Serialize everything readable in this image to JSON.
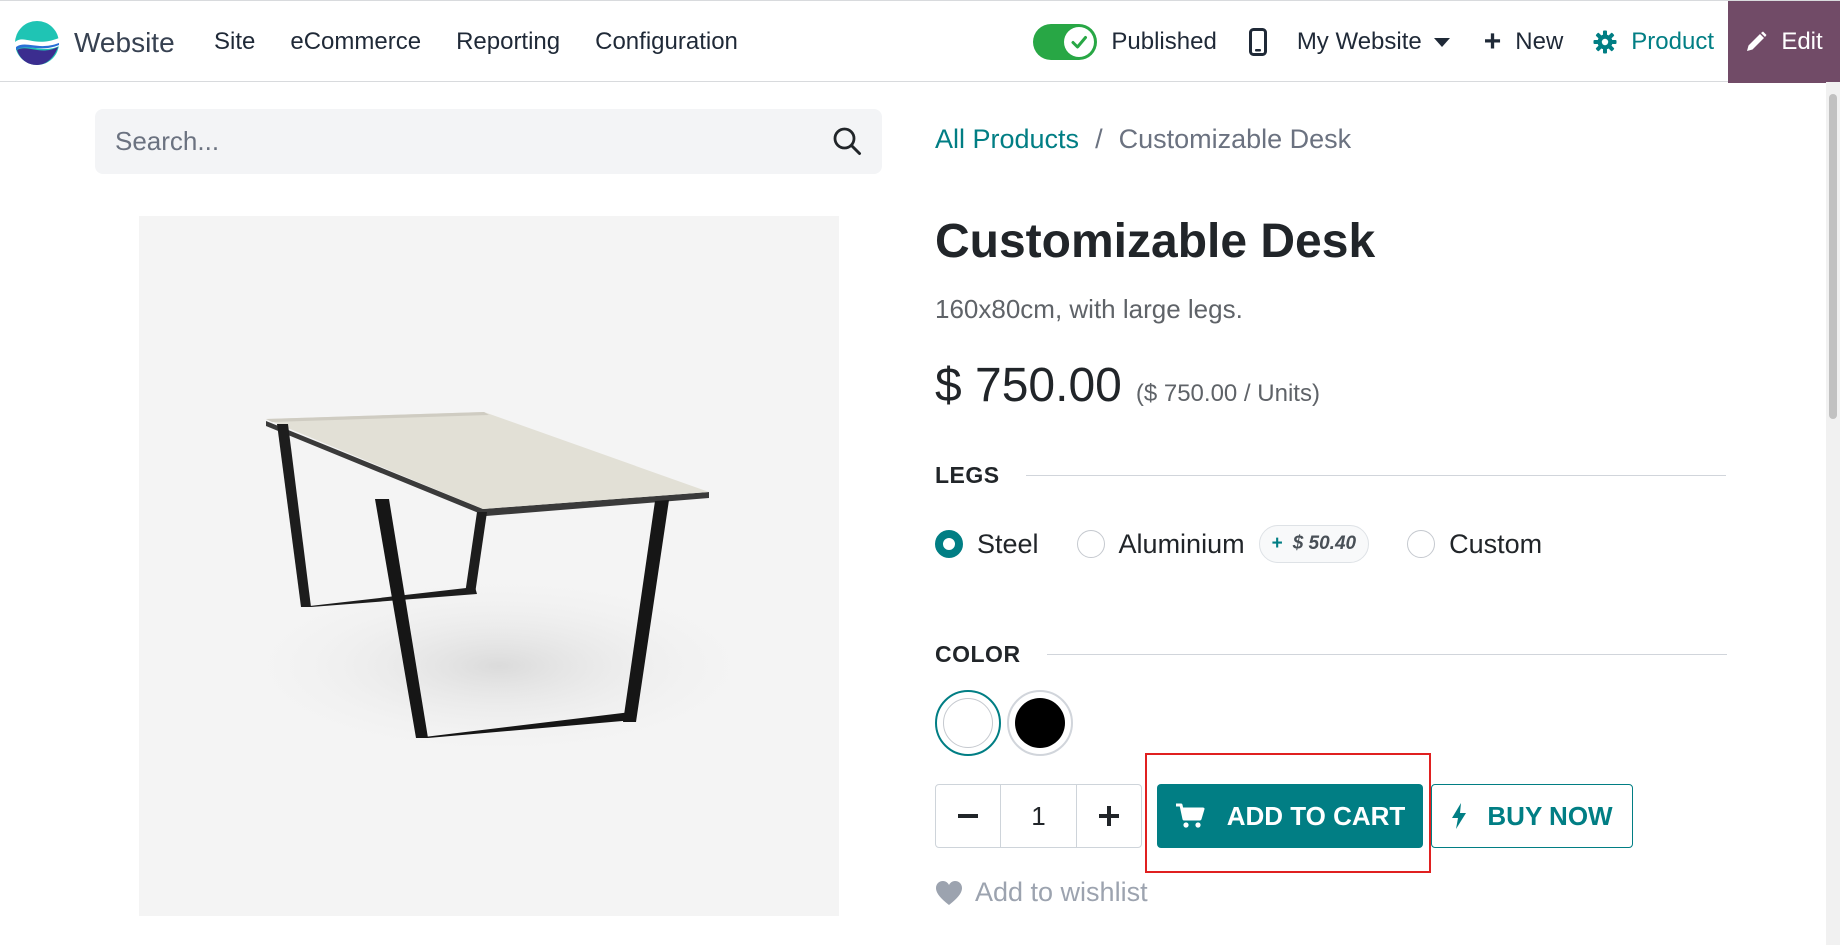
{
  "navbar": {
    "brand_label": "Website",
    "menu": [
      "Site",
      "eCommerce",
      "Reporting",
      "Configuration"
    ],
    "published_label": "Published",
    "published_on": true,
    "website_label": "My Website",
    "new_label": "New",
    "product_label": "Product",
    "edit_label": "Edit",
    "icons": [
      "website-logo-icon",
      "check-icon",
      "mobile-phone-icon",
      "caret-down-icon",
      "plus-icon",
      "gear-icon",
      "pencil-icon"
    ]
  },
  "search": {
    "placeholder": "Search..."
  },
  "breadcrumb": {
    "link": "All Products",
    "separator": "/",
    "current": "Customizable Desk"
  },
  "product": {
    "title": "Customizable Desk",
    "description": "160x80cm, with large legs.",
    "price": "$ 750.00",
    "unit_price": "($ 750.00 / Units)"
  },
  "legs": {
    "label": "LEGS",
    "options": [
      {
        "label": "Steel",
        "selected": true
      },
      {
        "label": "Aluminium",
        "selected": false,
        "extra_sign": "+",
        "extra_amount": "$ 50.40"
      },
      {
        "label": "Custom",
        "selected": false
      }
    ]
  },
  "color": {
    "label": "COLOR",
    "swatches": [
      {
        "name": "White",
        "hex": "#ffffff",
        "selected": true
      },
      {
        "name": "Black",
        "hex": "#000000",
        "selected": false
      }
    ]
  },
  "cart": {
    "quantity": "1",
    "add_to_cart_label": "ADD TO CART",
    "buy_now_label": "BUY NOW",
    "wishlist_label": "Add to wishlist"
  },
  "colors": {
    "primary": "#017e84",
    "edit_button": "#714b67",
    "toggle_on": "#28a745",
    "highlight": "#e02020"
  }
}
